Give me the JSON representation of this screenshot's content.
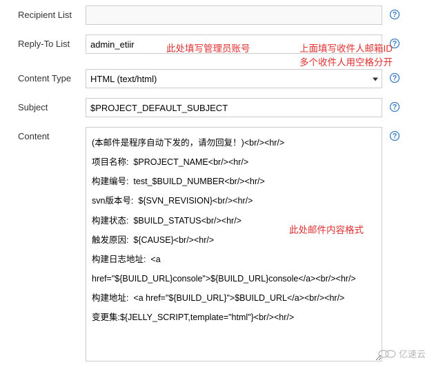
{
  "labels": {
    "recipient": "Recipient List",
    "replyto": "Reply-To List",
    "contentType": "Content Type",
    "subject": "Subject",
    "content": "Content"
  },
  "values": {
    "recipient": "",
    "replyto": "admin_etiir",
    "contentType": "HTML (text/html)",
    "subject": "$PROJECT_DEFAULT_SUBJECT",
    "content": "(本邮件是程序自动下发的，请勿回复！)<br/><hr/>\n项目名称:  $PROJECT_NAME<br/><hr/>\n构建编号:  test_$BUILD_NUMBER<br/><hr/>\nsvn版本号:  ${SVN_REVISION}<br/><hr/>\n构建状态:  $BUILD_STATUS<br/><hr/>\n触发原因:  ${CAUSE}<br/><hr/>\n构建日志地址:  <a href=\"${BUILD_URL}console\">${BUILD_URL}console</a><br/><hr/>\n构建地址:  <a href=\"${BUILD_URL}\">$BUILD_URL</a><br/><hr/>\n变更集:${JELLY_SCRIPT,template=\"html\"}<br/><hr/>"
  },
  "annotations": {
    "a1": "此处填写管理员账号",
    "a2": "上面填写收件人邮箱ID",
    "a3": "多个收件人用空格分开",
    "a4": "此处邮件内容格式"
  },
  "watermark": "亿速云"
}
